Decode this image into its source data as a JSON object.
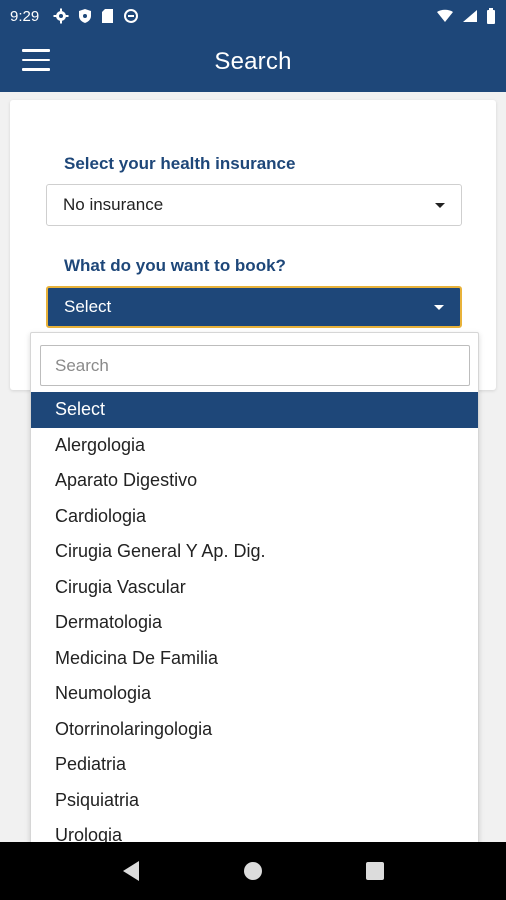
{
  "status_bar": {
    "time": "9:29",
    "left_icons": [
      "gear-icon",
      "shield-icon",
      "sim-card-icon",
      "sync-icon"
    ],
    "right_icons": [
      "wifi-icon",
      "signal-icon",
      "battery-icon"
    ]
  },
  "app_bar": {
    "title": "Search",
    "menu_icon": "hamburger-menu-icon"
  },
  "form": {
    "insurance_label": "Select your health insurance",
    "insurance_value": "No insurance",
    "book_label": "What do you want to book?",
    "book_value": "Select"
  },
  "dropdown": {
    "search_placeholder": "Search",
    "options": [
      "Select",
      "Alergologia",
      "Aparato Digestivo",
      "Cardiologia",
      "Cirugia General Y Ap. Dig.",
      "Cirugia Vascular",
      "Dermatologia",
      "Medicina De Familia",
      "Neumologia",
      "Otorrinolaringologia",
      "Pediatria",
      "Psiquiatria",
      "Urologia"
    ],
    "selected_index": 0
  },
  "nav_bar": {
    "buttons": [
      "back-icon",
      "home-icon",
      "recents-icon"
    ]
  },
  "colors": {
    "primary": "#1e4779",
    "focus_border": "#e8b23a",
    "background": "#f1f1f1"
  }
}
